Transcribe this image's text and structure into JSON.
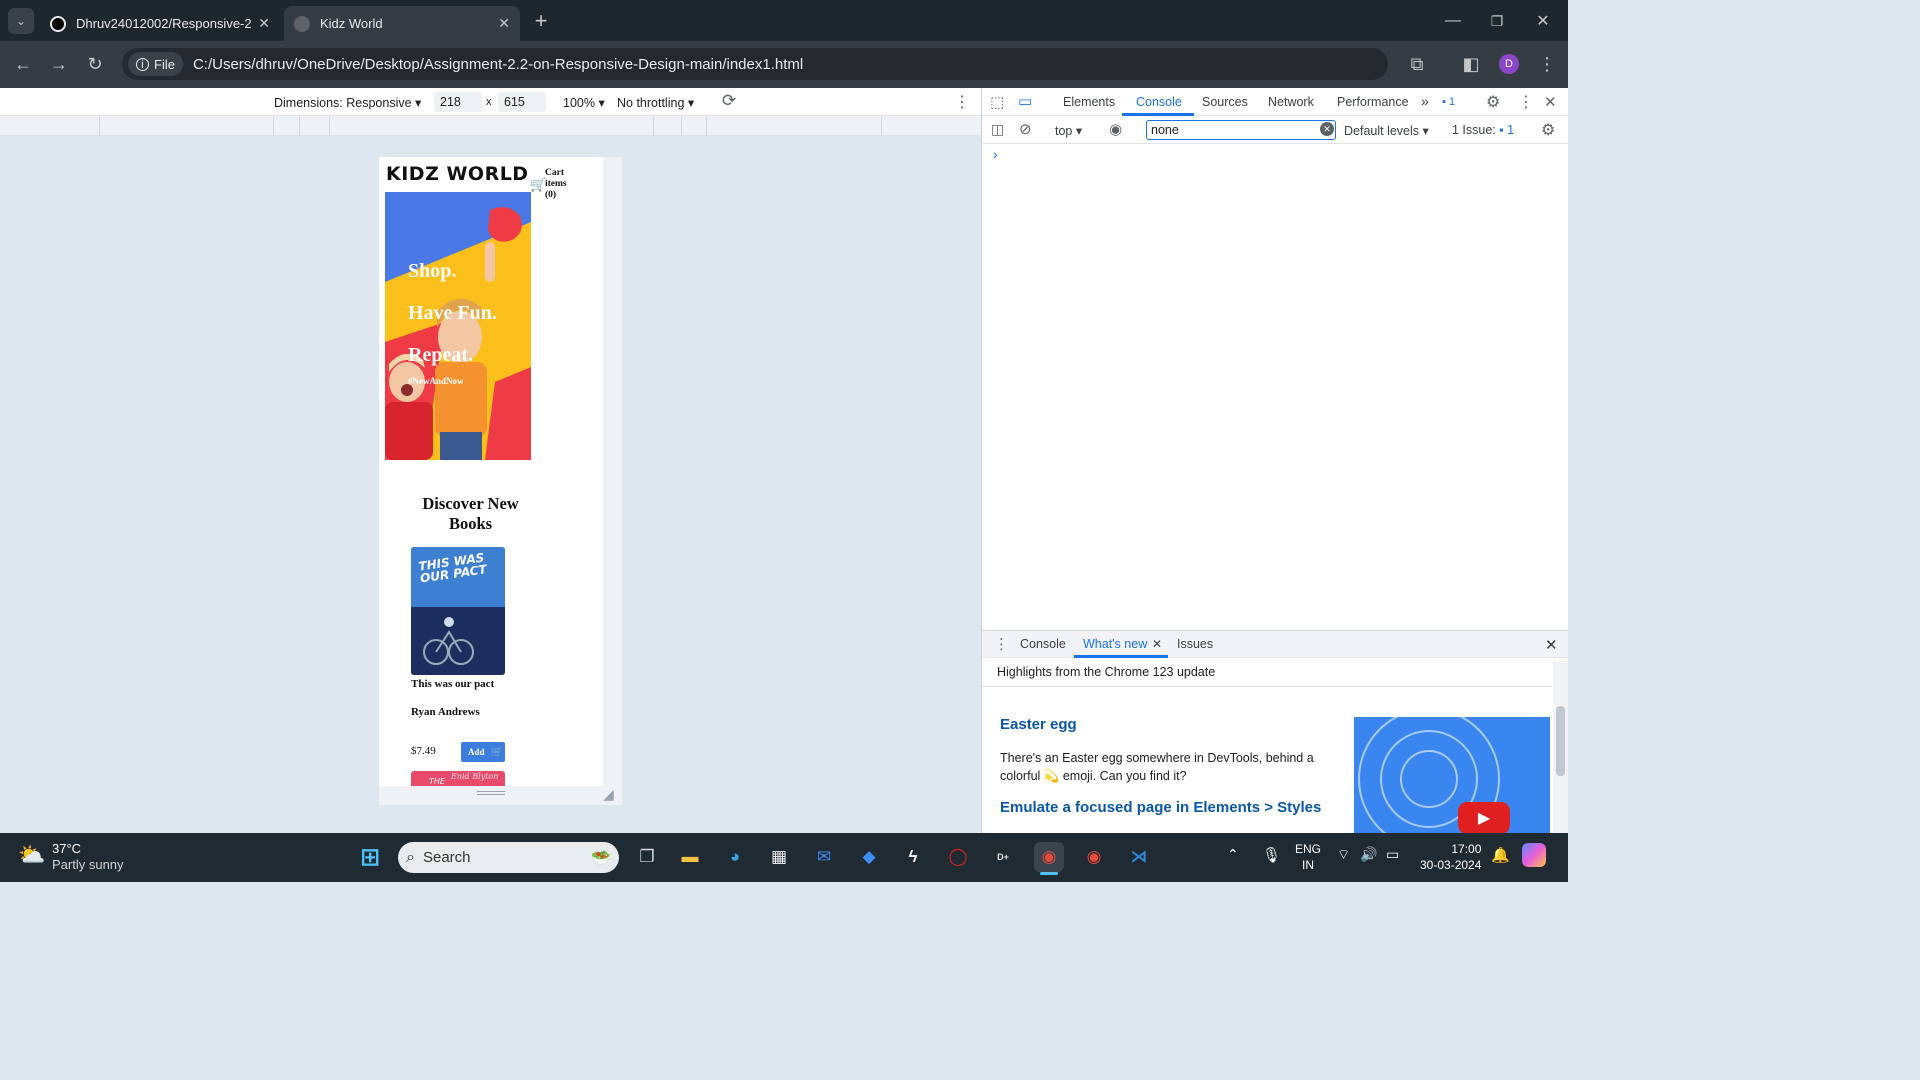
{
  "browser": {
    "tabs": [
      {
        "title": "Dhruv24012002/Responsive-2",
        "active": false
      },
      {
        "title": "Kidz World",
        "active": true
      }
    ],
    "scheme_chip": "File",
    "url": "C:/Users/dhruv/OneDrive/Desktop/Assignment-2.2-on-Responsive-Design-main/index1.html",
    "profile_initial": "D"
  },
  "device_toolbar": {
    "dimensions_label": "Dimensions: Responsive",
    "width": "218",
    "times": "x",
    "height": "615",
    "zoom": "100%",
    "throttling": "No throttling"
  },
  "page": {
    "logo": "KIDZ WORLD",
    "cart_label": "Cart items",
    "cart_count": "(0)",
    "hero_lines": [
      "Shop.",
      "Have Fun.",
      "Repeat."
    ],
    "hero_tag": "#NewAndNow",
    "section_title": "Discover New Books",
    "book": {
      "cover_text": "THIS WAS OUR PACT",
      "title": "This was our pact",
      "author": "Ryan Andrews",
      "price": "$7.49",
      "add_label": "Add"
    },
    "next_cover_text": "THE",
    "next_cover_script": "Enid Blyton"
  },
  "devtools": {
    "tabs": [
      "Elements",
      "Console",
      "Sources",
      "Network",
      "Performance"
    ],
    "active_tab": "Console",
    "badge_count": "1",
    "context": "top",
    "filter_value": "none",
    "levels": "Default levels",
    "issues_label": "1 Issue:",
    "issues_count": "1",
    "prompt": "›",
    "drawer": {
      "tabs": [
        "Console",
        "What's new",
        "Issues"
      ],
      "active_tab": "What's new",
      "highlight": "Highlights from the Chrome 123 update",
      "heading1": "Easter egg",
      "body1": "There's an Easter egg somewhere in DevTools, behind a colorful",
      "body1b": "emoji. Can you find it?",
      "heading2": "Emulate a focused page in Elements > Styles"
    }
  },
  "taskbar": {
    "weather_temp": "37°C",
    "weather_desc": "Partly sunny",
    "search_placeholder": "Search",
    "lang1": "ENG",
    "lang2": "IN",
    "time": "17:00",
    "date": "30-03-2024"
  },
  "colors": {
    "accent_blue": "#1a73e8",
    "hero_yellow": "#fbbf1c",
    "hero_red": "#ee3b46",
    "hero_blue": "#4a78e6",
    "link_teal": "#0b57a8"
  }
}
